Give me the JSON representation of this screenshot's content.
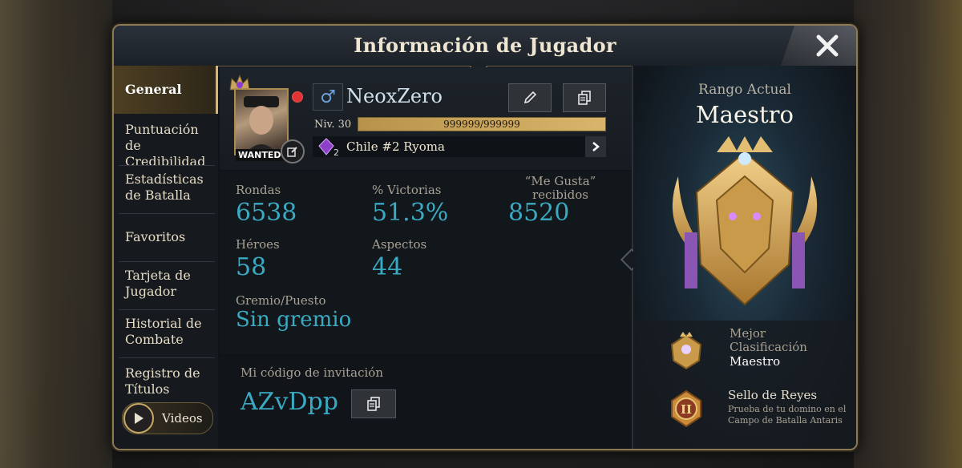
{
  "header": {
    "title": "Información de Jugador"
  },
  "sidebar": {
    "items": [
      {
        "label": "General"
      },
      {
        "label": "Puntuación de Credibilidad"
      },
      {
        "label": "Estadísticas de Batalla"
      },
      {
        "label": "Favoritos"
      },
      {
        "label": "Tarjeta de Jugador"
      },
      {
        "label": "Historial de Combate"
      },
      {
        "label": "Registro de Títulos"
      }
    ],
    "videos_label": "Videos"
  },
  "profile": {
    "name": "NeoxZero",
    "gender_icon": "male-icon",
    "avatar_tag": "WANTED",
    "level": "Niv. 30",
    "xp_text": "999999/999999",
    "xp_fraction": 1.0,
    "rank_text": "Chile #2 Ryoma",
    "rank_badge_num": "2"
  },
  "stats": {
    "rounds_label": "Rondas",
    "rounds": "6538",
    "winrate_label": "% Victorias",
    "winrate": "51.3%",
    "likes_label": "“Me Gusta” recibidos",
    "likes": "8520",
    "heroes_label": "Héroes",
    "heroes": "58",
    "skins_label": "Aspectos",
    "skins": "44",
    "guild_label": "Gremio/Puesto",
    "guild": "Sin gremio"
  },
  "invite": {
    "label": "Mi código de invitación",
    "code": "AZvDpp"
  },
  "rank_panel": {
    "caption": "Rango Actual",
    "rank": "Maestro",
    "best_label": "Mejor Clasificación",
    "best_value": "Maestro",
    "seal_title": "Sello de Reyes",
    "seal_desc": "Prueba de tu domino en el Campo de Batalla Antaris",
    "seal_num": "II"
  },
  "colors": {
    "accent_gold": "#d8b56a",
    "stat_value": "#3aa9c2"
  }
}
